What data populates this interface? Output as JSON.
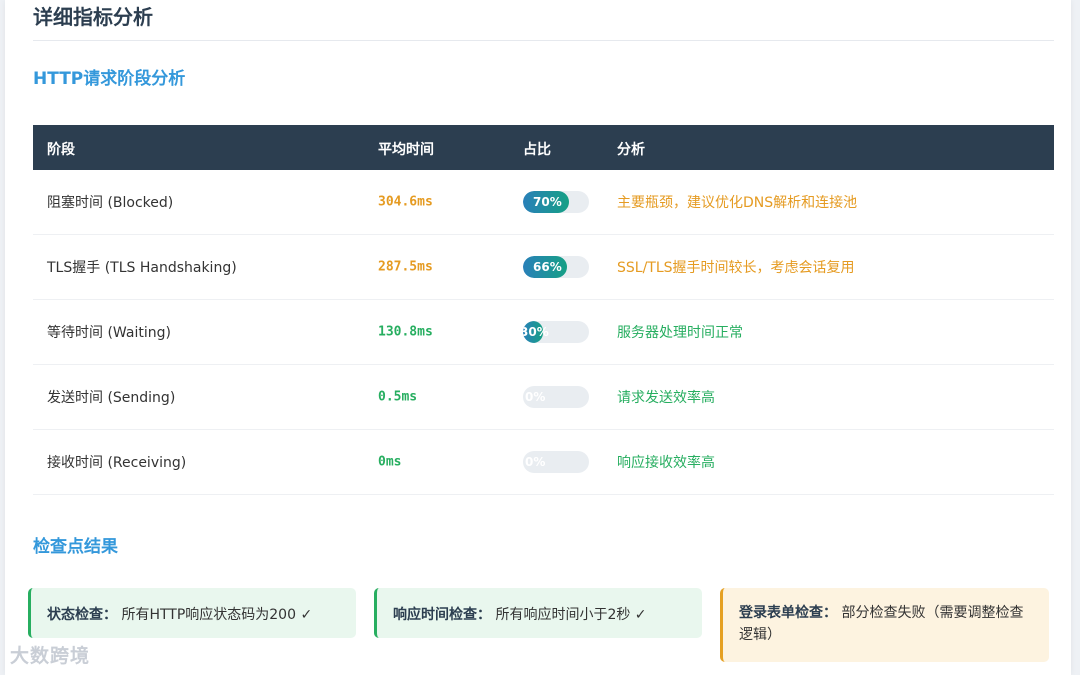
{
  "page_title": "详细指标分析",
  "http_section_title": "HTTP请求阶段分析",
  "table": {
    "headers": [
      "阶段",
      "平均时间",
      "占比",
      "分析"
    ],
    "rows": [
      {
        "stage": "阻塞时间 (Blocked)",
        "time": "304.6ms",
        "percent": 70,
        "percent_label": "70%",
        "analysis": "主要瓶颈，建议优化DNS解析和连接池",
        "status": "warn"
      },
      {
        "stage": "TLS握手 (TLS Handshaking)",
        "time": "287.5ms",
        "percent": 66,
        "percent_label": "66%",
        "analysis": "SSL/TLS握手时间较长，考虑会话复用",
        "status": "warn"
      },
      {
        "stage": "等待时间 (Waiting)",
        "time": "130.8ms",
        "percent": 30,
        "percent_label": "30%",
        "analysis": "服务器处理时间正常",
        "status": "good"
      },
      {
        "stage": "发送时间 (Sending)",
        "time": "0.5ms",
        "percent": 0,
        "percent_label": "0%",
        "analysis": "请求发送效率高",
        "status": "good"
      },
      {
        "stage": "接收时间 (Receiving)",
        "time": "0ms",
        "percent": 0,
        "percent_label": "0%",
        "analysis": "响应接收效率高",
        "status": "good"
      }
    ]
  },
  "checkpoint_section_title": "检查点结果",
  "checkpoints": [
    {
      "label": "状态检查：",
      "text": "所有HTTP响应状态码为200 ✓",
      "status": "ok"
    },
    {
      "label": "响应时间检查：",
      "text": "所有响应时间小于2秒 ✓",
      "status": "ok"
    },
    {
      "label": "登录表单检查：",
      "text": "部分检查失败（需要调整检查逻辑）",
      "status": "bad"
    }
  ],
  "watermark": "大数跨境",
  "colors": {
    "header_bg": "#2c3e50",
    "accent": "#3498db",
    "warn": "#e59b22",
    "good": "#27ae60"
  }
}
